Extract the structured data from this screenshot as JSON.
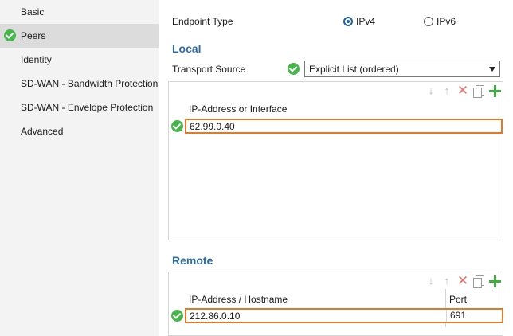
{
  "sidebar": {
    "items": [
      {
        "label": "Basic"
      },
      {
        "label": "Peers"
      },
      {
        "label": "Identity"
      },
      {
        "label": "SD-WAN - Bandwidth Protection"
      },
      {
        "label": "SD-WAN - Envelope Protection"
      },
      {
        "label": "Advanced"
      }
    ],
    "active_item": "Peers"
  },
  "endpoint": {
    "label": "Endpoint Type",
    "options": [
      {
        "label": "IPv4",
        "selected": true
      },
      {
        "label": "IPv6",
        "selected": false
      }
    ]
  },
  "local": {
    "title": "Local",
    "transport_label": "Transport Source",
    "transport_value": "Explicit List (ordered)",
    "table": {
      "columns": [
        "IP-Address or Interface"
      ],
      "rows": [
        {
          "value": "62.99.0.40",
          "status": "ok"
        }
      ]
    }
  },
  "remote": {
    "title": "Remote",
    "table": {
      "columns": [
        "IP-Address / Hostname",
        "Port"
      ],
      "rows": [
        {
          "host": "212.86.0.10",
          "port": "691",
          "status": "ok"
        }
      ]
    }
  },
  "toolbar_icons": [
    "arrow-down-icon",
    "arrow-up-icon",
    "delete-icon",
    "copy-icon",
    "add-icon"
  ],
  "colors": {
    "accent": "#2e6da4",
    "ok": "#46b64a",
    "selection_border": "#e07a28",
    "delete": "#e8706a",
    "add": "#3fae3f"
  }
}
